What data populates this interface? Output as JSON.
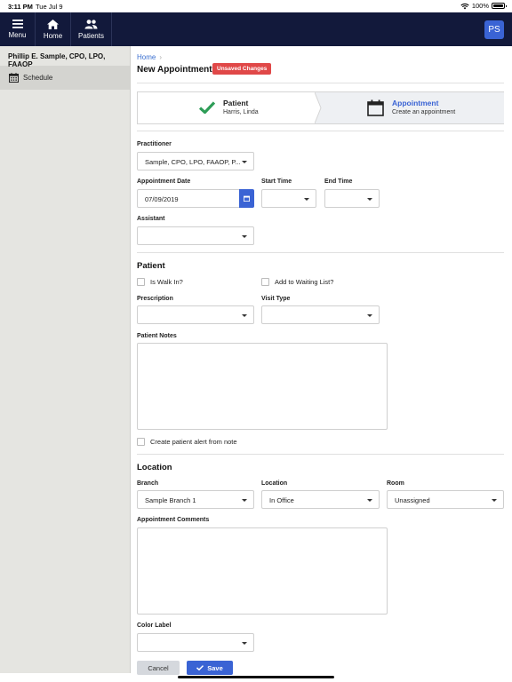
{
  "status": {
    "time": "3:11 PM",
    "date": "Tue Jul 9",
    "battery": "100%"
  },
  "nav": {
    "menu_label": "Menu",
    "home_label": "Home",
    "patients_label": "Patients",
    "avatar_initials": "PS"
  },
  "sidebar": {
    "user_name": "Phillip E. Sample, CPO, LPO, FAAOP",
    "schedule_label": "Schedule"
  },
  "header": {
    "breadcrumb_home": "Home",
    "title": "New Appointment",
    "badge": "Unsaved Changes"
  },
  "stepper": {
    "step1": {
      "title": "Patient",
      "subtitle": "Harris, Linda"
    },
    "step2": {
      "title": "Appointment",
      "subtitle": "Create an appointment"
    }
  },
  "form": {
    "practitioner_label": "Practitioner",
    "practitioner_value": "Sample, CPO, LPO, FAAOP, P...",
    "appointment_date_label": "Appointment Date",
    "appointment_date_value": "07/09/2019",
    "start_time_label": "Start Time",
    "end_time_label": "End Time",
    "assistant_label": "Assistant"
  },
  "patient_section": {
    "title": "Patient",
    "walk_in_label": "Is Walk In?",
    "waiting_list_label": "Add to Waiting List?",
    "prescription_label": "Prescription",
    "visit_type_label": "Visit Type",
    "notes_label": "Patient Notes",
    "alert_label": "Create patient alert from note"
  },
  "location_section": {
    "title": "Location",
    "branch_label": "Branch",
    "branch_value": "Sample Branch 1",
    "location_label": "Location",
    "location_value": "In Office",
    "room_label": "Room",
    "room_value": "Unassigned",
    "comments_label": "Appointment Comments",
    "color_label": "Color Label"
  },
  "actions": {
    "cancel_label": "Cancel",
    "save_label": "Save"
  },
  "colors": {
    "nav_bg": "#12193b",
    "accent": "#3a63d4",
    "badge": "#e04848",
    "check_green": "#2e9d57"
  }
}
